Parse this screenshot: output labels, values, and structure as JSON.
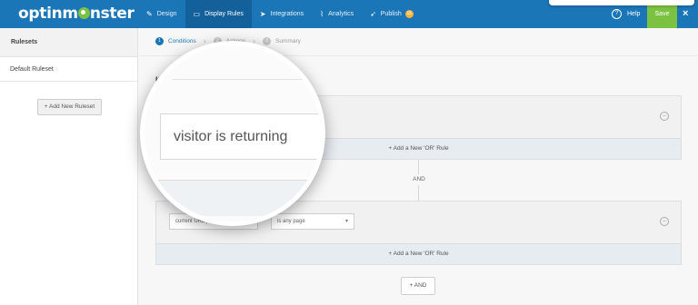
{
  "app": {
    "logo_text": "optinm",
    "logo_text_end": "nster"
  },
  "nav": {
    "items": [
      {
        "label": "Design",
        "icon": "pencil-icon",
        "active": false
      },
      {
        "label": "Display Rules",
        "icon": "monitor-icon",
        "active": true
      },
      {
        "label": "Integrations",
        "icon": "paper-plane-icon",
        "active": false
      },
      {
        "label": "Analytics",
        "icon": "chart-icon",
        "active": false
      },
      {
        "label": "Publish",
        "icon": "rocket-icon",
        "active": false,
        "badge": "15"
      }
    ],
    "help_label": "Help",
    "save_label": "Save",
    "close_label": "×"
  },
  "sidebar": {
    "title": "Rulesets",
    "items": [
      {
        "label": "Default Ruleset"
      }
    ],
    "add_label": "+ Add New Ruleset"
  },
  "steps": [
    {
      "num": "1",
      "label": "Conditions",
      "active": true
    },
    {
      "num": "2",
      "label": "Actions",
      "active": false
    },
    {
      "num": "3",
      "label": "Summary",
      "active": false
    }
  ],
  "rules": {
    "if_label": "If",
    "group1": {
      "or_label": "+ Add a New 'OR' Rule"
    },
    "and_connector": "AND",
    "group2": {
      "condition": "current URL path",
      "operator": "is any page",
      "or_label": "+ Add a New 'OR' Rule"
    },
    "and_button": "+ AND"
  },
  "magnifier": {
    "field_text": "visitor is returning"
  },
  "colors": {
    "topbar": "#1b76b8",
    "nav_active": "#13609a",
    "save": "#7cc242",
    "accent": "#1b76b8"
  }
}
